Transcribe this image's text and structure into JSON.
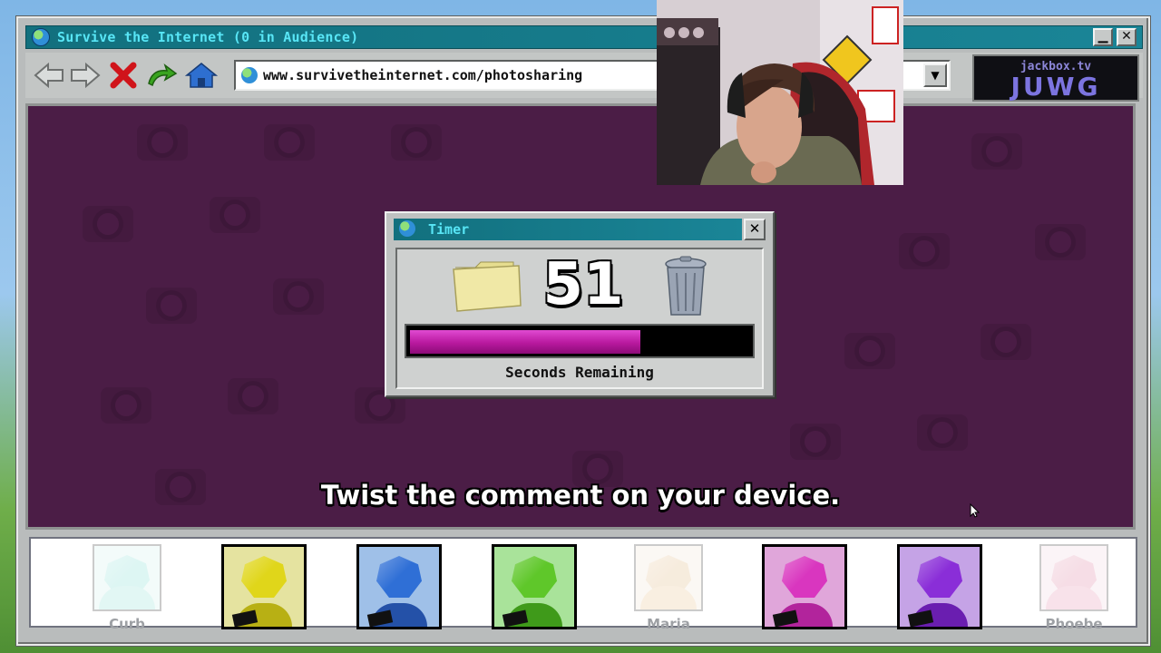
{
  "window": {
    "title": "Survive the Internet (0 in Audience)",
    "minimize_label": "▁",
    "close_label": "✕"
  },
  "toolbar": {
    "back_icon": "back-arrow-icon",
    "forward_icon": "forward-arrow-icon",
    "stop_icon": "stop-x-icon",
    "refresh_icon": "refresh-arrow-icon",
    "home_icon": "home-icon",
    "url": "www.survivetheinternet.com/photosharing",
    "dropdown_label": "▼"
  },
  "room": {
    "site": "jackbox.tv",
    "code": "JUWG"
  },
  "timer": {
    "title": "Timer",
    "close_label": "✕",
    "seconds": "51",
    "label": "Seconds Remaining",
    "progress_fraction": 0.68,
    "progress_color": "#c21aa8"
  },
  "instruction": "Twist the comment on your device.",
  "players": [
    {
      "name": "Curb",
      "state": "empty",
      "head": "#9fe6de",
      "body": "#aee9e2",
      "bg": "#dff5f2"
    },
    {
      "name": "",
      "state": "joined",
      "head": "#e0d61a",
      "body": "#b8b014",
      "bg": "#e5e3a0"
    },
    {
      "name": "",
      "state": "joined",
      "head": "#2f6fd6",
      "body": "#2451a8",
      "bg": "#9fc0e8"
    },
    {
      "name": "",
      "state": "joined",
      "head": "#5fc72a",
      "body": "#3f9a1a",
      "bg": "#a9e39a"
    },
    {
      "name": "Maria",
      "state": "empty",
      "head": "#e8c9a0",
      "body": "#efd2ac",
      "bg": "#f6ece0"
    },
    {
      "name": "",
      "state": "joined",
      "head": "#d936bf",
      "body": "#b2249c",
      "bg": "#e0a6da"
    },
    {
      "name": "",
      "state": "joined",
      "head": "#8a2ed8",
      "body": "#6a1eb0",
      "bg": "#c5a3e6"
    },
    {
      "name": "Phoebe",
      "state": "empty",
      "head": "#e6a0b8",
      "body": "#ecaec4",
      "bg": "#f6e2ea"
    }
  ],
  "webcam": {
    "icon": "webcam-person-icon"
  }
}
